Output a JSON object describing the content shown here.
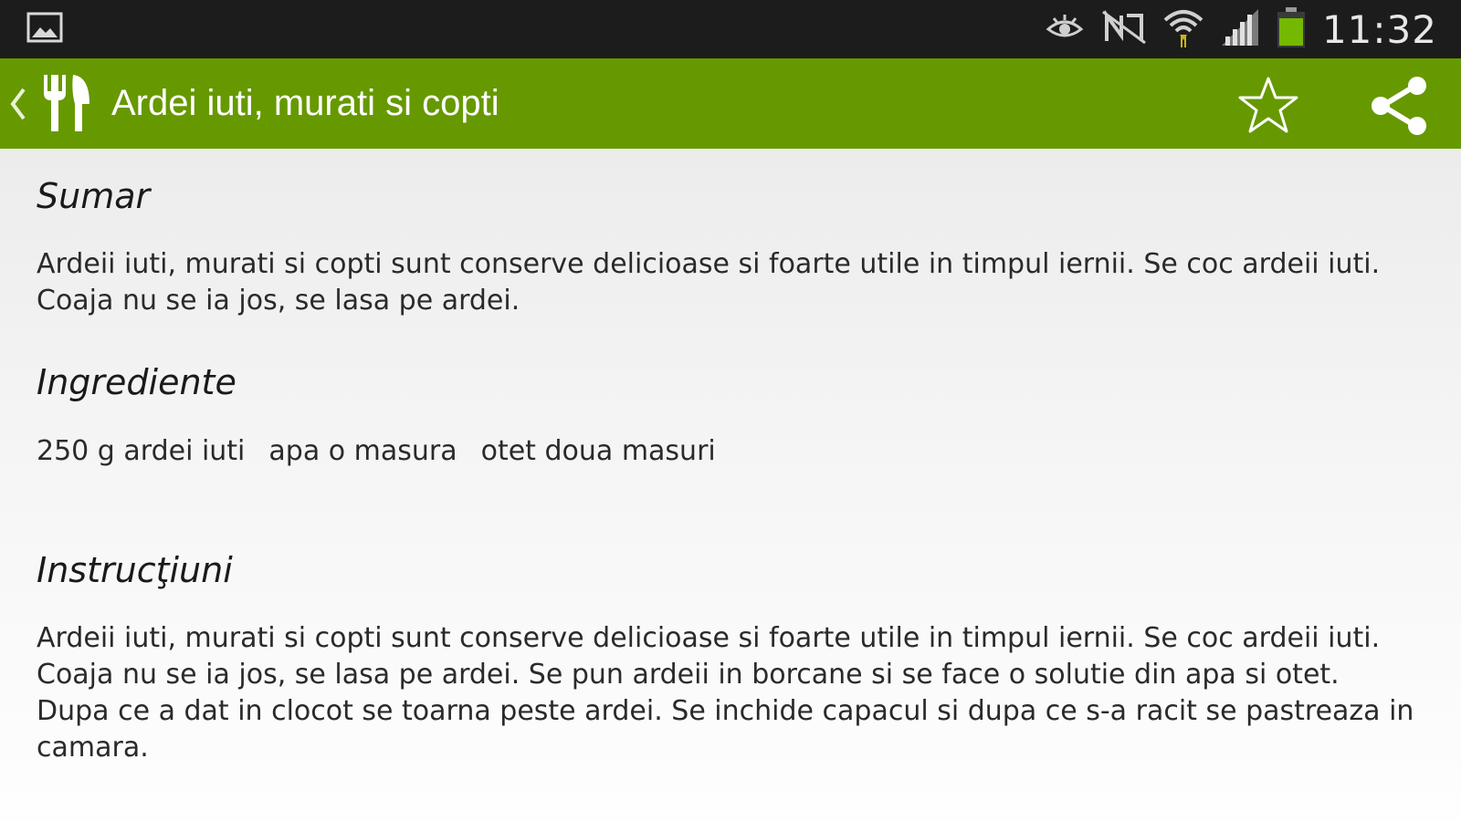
{
  "status_bar": {
    "time": "11:32",
    "icons": [
      "gallery-notification-icon",
      "eye-icon",
      "nfc-icon",
      "wifi-icon",
      "signal-icon",
      "battery-icon"
    ],
    "background": "#1c1c1c"
  },
  "action_bar": {
    "title": "Ardei iuti, murati si copti",
    "background": "#669900",
    "icons": [
      "back-chevron-icon",
      "fork-knife-icon",
      "star-icon",
      "share-icon"
    ]
  },
  "recipe": {
    "summary_heading": "Sumar",
    "summary_text": "Ardeii iuti, murati si copti sunt conserve delicioase si foarte utile in timpul iernii. Se coc ardeii iuti. Coaja nu se ia jos, se lasa pe ardei.",
    "ingredients_heading": "Ingrediente",
    "ingredients": [
      "250 g ardei iuti",
      "apa o masura",
      "otet doua masuri"
    ],
    "instructions_heading": "Instrucţiuni",
    "instructions_text": "Ardeii iuti, murati si copti sunt conserve delicioase si foarte utile in timpul iernii.  Se coc ardeii iuti. Coaja nu se ia jos, se lasa pe ardei. Se pun ardeii in borcane si se face o solutie din apa si otet. Dupa ce a dat in clocot se toarna peste ardei. Se inchide capacul si dupa ce s-a racit se pastreaza in camara."
  }
}
